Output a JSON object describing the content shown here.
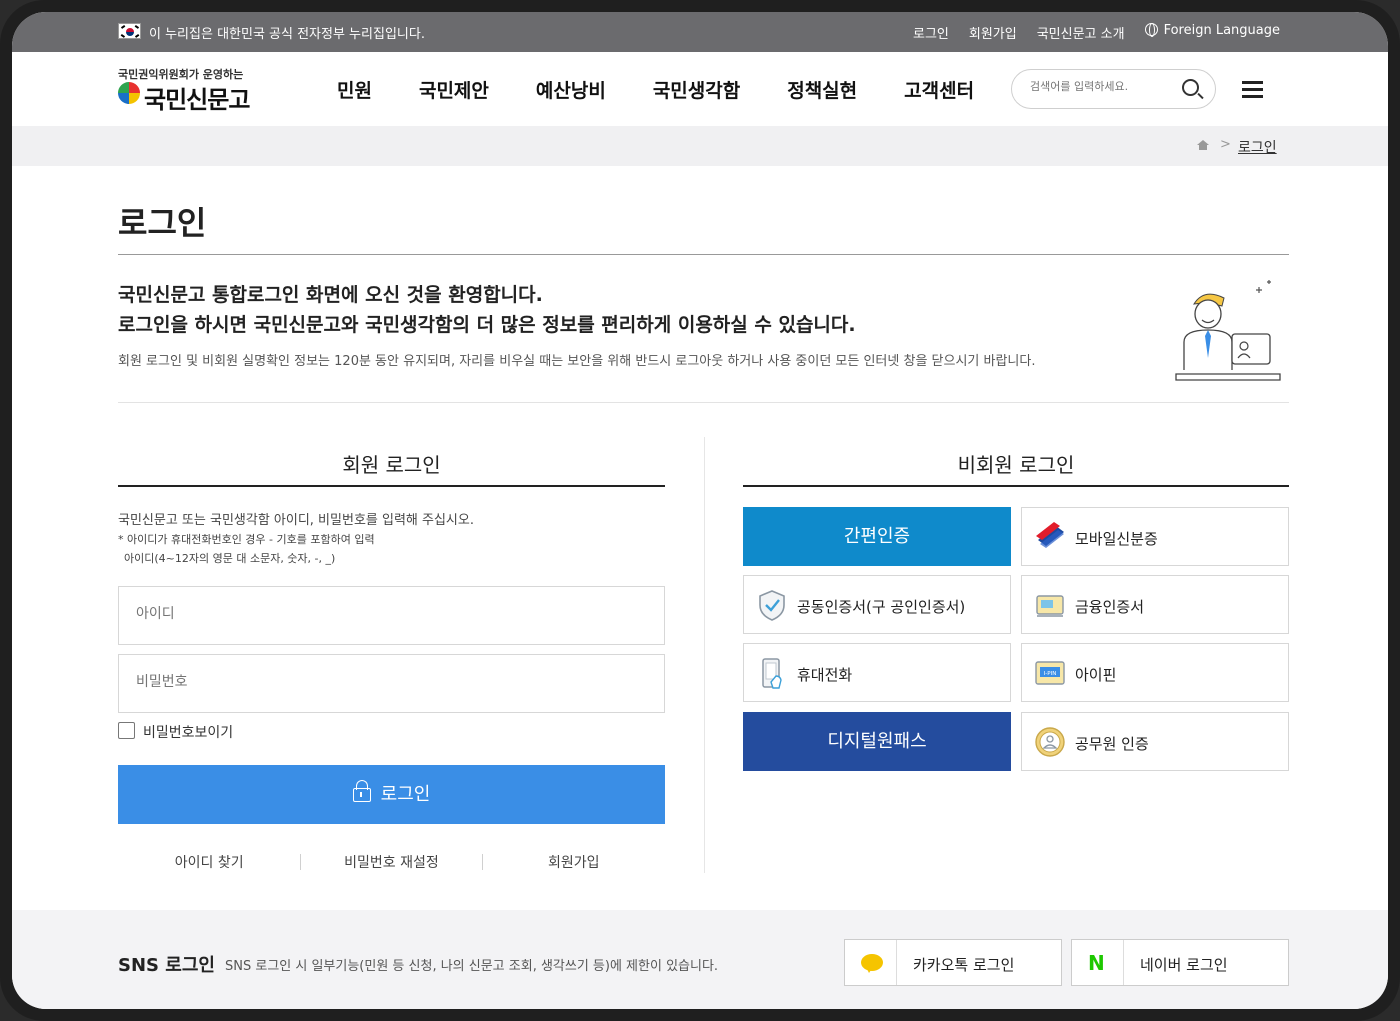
{
  "gov_bar": {
    "official_text": "이 누리집은 대한민국 공식 전자정부 누리집입니다.",
    "links": [
      "로그인",
      "회원가입",
      "국민신문고 소개"
    ],
    "foreign_language": "Foreign Language"
  },
  "header": {
    "logo_sub": "국민권익위원회가 운영하는",
    "logo_text": "국민신문고",
    "nav": [
      "민원",
      "국민제안",
      "예산낭비",
      "국민생각함",
      "정책실현",
      "고객센터"
    ],
    "search_placeholder": "검색어를 입력하세요."
  },
  "breadcrumb": {
    "separator": ">",
    "current": "로그인"
  },
  "page": {
    "title": "로그인",
    "welcome_line1": "국민신문고 통합로그인 화면에 오신 것을 환영합니다.",
    "welcome_line2": "로그인을 하시면 국민신문고와 국민생각함의 더 많은 정보를 편리하게 이용하실 수 있습니다.",
    "notice": "회원 로그인 및 비회원 실명확인 정보는 120분 동안 유지되며, 자리를 비우실 때는 보안을 위해 반드시 로그아웃 하거나 사용 중이던 모든 인터넷 창을 닫으시기 바랍니다."
  },
  "member_login": {
    "title": "회원 로그인",
    "desc": "국민신문고 또는 국민생각함 아이디, 비밀번호를 입력해 주십시오.",
    "note1": "* 아이디가 휴대전화번호인 경우 - 기호를 포함하여 입력",
    "note2": "아이디(4~12자의 영문 대 소문자, 숫자, -, _)",
    "id_placeholder": "아이디",
    "password_placeholder": "비밀번호",
    "show_password_label": "비밀번호보이기",
    "login_button": "로그인",
    "links": [
      "아이디 찾기",
      "비밀번호 재설정",
      "회원가입"
    ]
  },
  "nonmember_login": {
    "title": "비회원 로그인",
    "options": [
      {
        "label": "간편인증",
        "icon": "none",
        "color": "#0f8acb"
      },
      {
        "label": "모바일신분증",
        "icon": "mobile-id-icon"
      },
      {
        "label": "공동인증서(구 공인인증서)",
        "icon": "shield-check-icon"
      },
      {
        "label": "금융인증서",
        "icon": "financial-cert-icon"
      },
      {
        "label": "휴대전화",
        "icon": "phone-icon"
      },
      {
        "label": "아이핀",
        "icon": "ipin-icon",
        "icon_text": "I-PIN"
      },
      {
        "label": "디지털원패스",
        "icon": "none",
        "color": "#244c9e"
      },
      {
        "label": "공무원 인증",
        "icon": "official-badge-icon"
      }
    ]
  },
  "sns": {
    "title": "SNS 로그인",
    "desc": "SNS 로그인 시 일부기능(민원 등 신청, 나의 신문고 조회, 생각쓰기 등)에 제한이 있습니다.",
    "kakao_label": "카카오톡 로그인",
    "naver_label": "네이버 로그인",
    "naver_icon_text": "N"
  }
}
